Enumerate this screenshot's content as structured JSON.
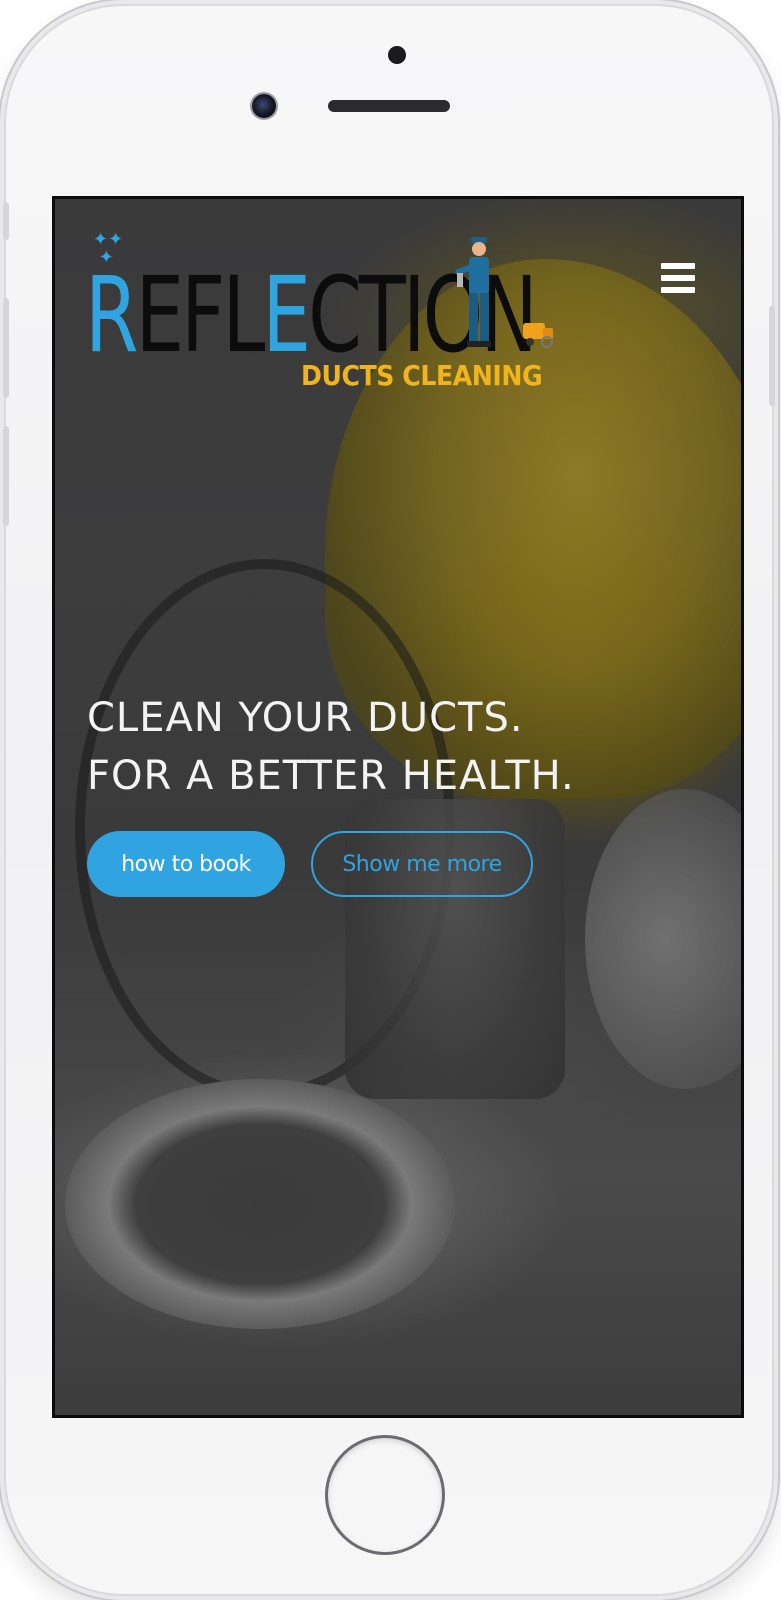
{
  "device": {
    "type": "phone mockup"
  },
  "header": {
    "logo": {
      "word_prefix": "R",
      "word_part1": "EFL",
      "word_part2": "E",
      "word_part3": "CTI",
      "word_part4": "ON",
      "subtitle": "DUCTS CLEANING"
    },
    "menu_icon": "hamburger-menu-icon"
  },
  "hero": {
    "headline_line1": "CLEAN YOUR DUCTS.",
    "headline_line2": "FOR A BETTER HEALTH.",
    "primary_button": "how to book",
    "secondary_button": "Show me more"
  },
  "colors": {
    "accent": "#2fa4e0",
    "logo_subtitle": "#f0b41c",
    "headline": "#f3f3f3"
  }
}
